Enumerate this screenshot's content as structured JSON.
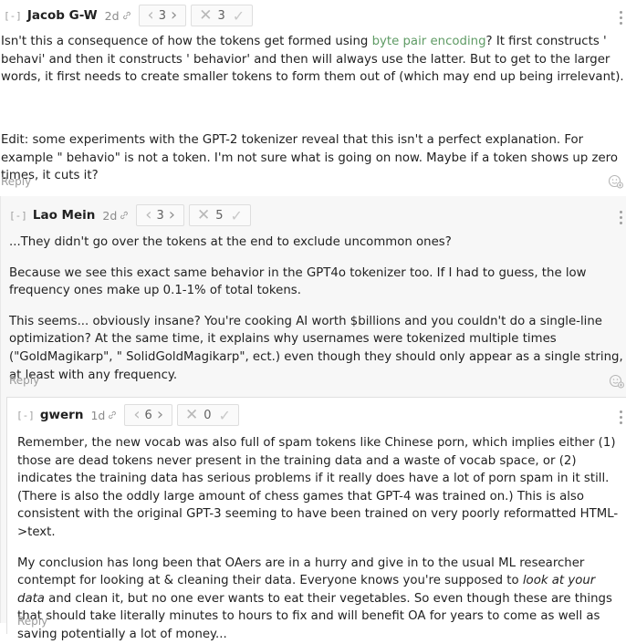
{
  "comments": [
    {
      "collapse": "[-]",
      "author": "Jacob G-W",
      "date": "2d",
      "karma": "3",
      "agreement": "3",
      "body_pre_link": "Isn't this a consequence of how the tokens get formed using ",
      "link": "byte pair encoding",
      "body_post_link": "? It first constructs ' behavi' and then it constructs ' behavior' and then will always use the latter. But to get to the larger words, it first needs to create smaller tokens to form them out of (which may end up being irrelevant).",
      "edit": "Edit: some experiments with the GPT-2 tokenizer reveal that this isn't a perfect explanation. For example \" behavio\" is not a token. I'm not sure what is going on now. Maybe if a token shows up zero times, it cuts it?",
      "reply": "Reply"
    },
    {
      "collapse": "[-]",
      "author": "Lao Mein",
      "date": "2d",
      "karma": "3",
      "agreement": "5",
      "p1": "...They didn't go over the tokens at the end to exclude uncommon ones?",
      "p2": "Because we see this exact same behavior in the GPT4o tokenizer too. If I had to guess, the low frequency ones make up 0.1-1% of total tokens.",
      "p3": "This seems... obviously insane? You're cooking AI worth $billions and you couldn't do a single-line optimization? At the same time, it explains why usernames were tokenized multiple times (\"GoldMagikarp\", \" SolidGoldMagikarp\", ect.) even though they should only appear as a single string, at least with any frequency.",
      "reply": "Reply"
    },
    {
      "collapse": "[-]",
      "author": "gwern",
      "date": "1d",
      "karma": "6",
      "agreement": "0",
      "p1": "Remember, the new vocab was also full of spam tokens like Chinese porn, which implies either (1) those are dead tokens never present in the training data and a waste of vocab space, or (2) indicates the training data has serious problems if it really does have a lot of porn spam in it still. (There is also the oddly large amount of chess games that GPT-4 was trained on.) This is also consistent with the original GPT-3 seeming to have been trained on very poorly reformatted HTML->text.",
      "p2_pre": "My conclusion has long been that OAers are in a hurry and give in to the usual ML researcher contempt for looking at & cleaning their data. Everyone knows you're supposed to ",
      "p2_em": "look at your data",
      "p2_post": " and clean it, but no one ever wants to eat their vegetables. So even though these are things that should take literally minutes to hours to fix and will benefit OA for years to come as well as saving potentially a lot of money...",
      "reply": "Reply"
    }
  ],
  "colors": {
    "link": "#5f9b65",
    "text": "#222222",
    "muted": "#9a9a9a"
  }
}
